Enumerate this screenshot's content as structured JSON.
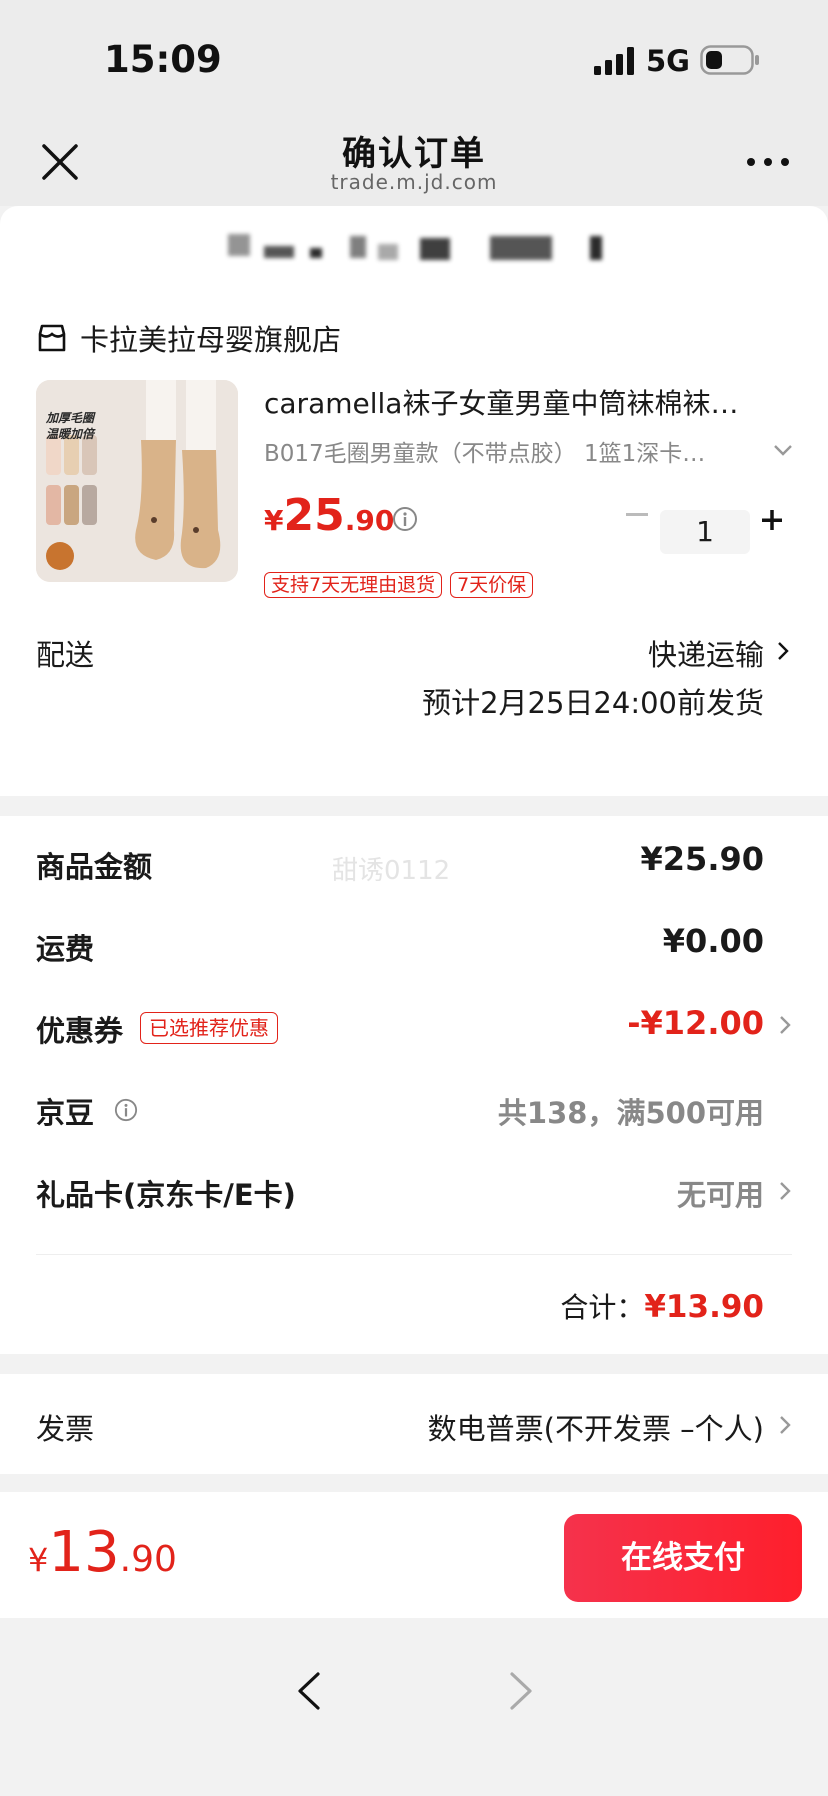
{
  "status_bar": {
    "time": "15:09",
    "network": "5G"
  },
  "nav": {
    "title": "确认订单",
    "url": "trade.m.jd.com"
  },
  "shop": {
    "name": "卡拉美拉母婴旗舰店"
  },
  "product": {
    "title": "caramella袜子女童男童中筒袜棉袜…",
    "spec": "B017毛圈男童款（不带点胶） 1篮1深卡…",
    "image_text": [
      "加厚毛圈",
      "温暖加倍"
    ],
    "price_symbol": "¥",
    "price_int": "25",
    "price_dec": ".90",
    "quantity": "1",
    "tags": [
      "支持7天无理由退货",
      "7天价保"
    ]
  },
  "delivery": {
    "label": "配送",
    "method": "快递运输",
    "estimate": "预计2月25日24:00前发货"
  },
  "summary": {
    "watermark": "甜诱0112",
    "goods_amount_label": "商品金额",
    "goods_amount_value": "¥25.90",
    "shipping_label": "运费",
    "shipping_value": "¥0.00",
    "coupon_label": "优惠券",
    "coupon_badge": "已选推荐优惠",
    "coupon_value": "-¥12.00",
    "jingdou_label": "京豆",
    "jingdou_value": "共138，满500可用",
    "giftcard_label": "礼品卡(京东卡/E卡)",
    "giftcard_value": "无可用",
    "total_label": "合计：",
    "total_value": "¥13.90"
  },
  "invoice": {
    "label": "发票",
    "value": "数电普票(不开发票 –个人)"
  },
  "bottom": {
    "symbol": "¥",
    "int": "13",
    "dec": ".90",
    "pay_label": "在线支付"
  },
  "colors": {
    "accent": "#e2231a",
    "pay_button": "#f5324c"
  }
}
